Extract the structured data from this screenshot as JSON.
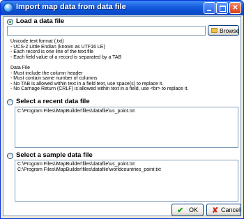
{
  "window": {
    "title": "Import map data from data file",
    "buttons": {
      "minimize": "",
      "maximize": "",
      "close": "✕"
    }
  },
  "load_section": {
    "title": "Load a data file",
    "file_path": "",
    "browse_label": "Browse",
    "info_lines": [
      "Unicode text format (.txt)",
      "- UCS-2 Little Endian (known as UTF16 LE)",
      "- Each record is one line of the text file",
      "- Each field value of a record is separated by a TAB",
      "",
      "Data File",
      "- Must include the column header",
      "- Must contain same number of columns",
      "- No TAB is allowed within text in a field text, use space(s) to replace it.",
      "- No Carriage Return (CRLF) is allowed within text in a field, use <br> to replace it."
    ]
  },
  "recent_section": {
    "title": "Select a recent data file",
    "items": [
      "C:\\Program Files\\iMapBuilder\\files\\datafile\\us_point.txt"
    ]
  },
  "sample_section": {
    "title": "Select a sample data file",
    "items": [
      "C:\\Program Files\\iMapBuilder\\files\\datafile\\us_point.txt",
      "C:\\Program Files\\iMapBuilder\\files\\datafile\\worldcountries_point.txt"
    ]
  },
  "footer": {
    "ok_label": "OK",
    "cancel_label": "Cancel"
  },
  "colors": {
    "titlebar": "#0a4fd0",
    "ok_check": "#1d9e1d",
    "cancel_x": "#d22a1e",
    "radio_dot": "#21a121"
  },
  "icons": {
    "title": "globe-icon",
    "browse": "folder-icon",
    "ok": "check-icon",
    "cancel": "cross-icon"
  }
}
